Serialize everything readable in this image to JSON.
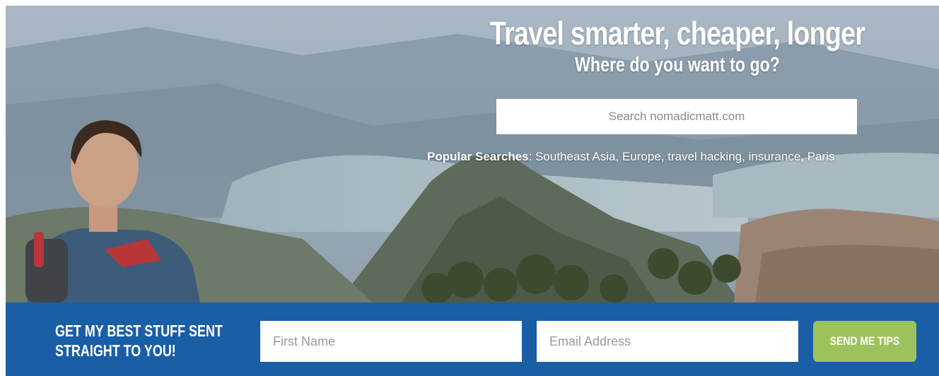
{
  "hero": {
    "title": "Travel smarter, cheaper, longer",
    "subtitle": "Where do you want to go?",
    "search": {
      "placeholder": "Search nomadicmatt.com"
    },
    "popular_label": "Popular Searches",
    "popular_separator": ": ",
    "popular_items": [
      {
        "label": "Southeast Asia",
        "sep": ", "
      },
      {
        "label": "Europe",
        "sep": ", "
      },
      {
        "label": "travel hacking",
        "sep": ", "
      },
      {
        "label": "insurance",
        "sep": ", "
      },
      {
        "label": "Paris",
        "sep": ""
      }
    ]
  },
  "signup": {
    "headline_line1": "Get my best stuff sent",
    "headline_line2": "straight to you!",
    "first_name_placeholder": "First Name",
    "email_placeholder": "Email Address",
    "button_label": "Send me tips"
  },
  "colors": {
    "signup_bg": "#1a5ea6",
    "button_bg": "#9dc25c",
    "text_light": "#ffffff"
  }
}
